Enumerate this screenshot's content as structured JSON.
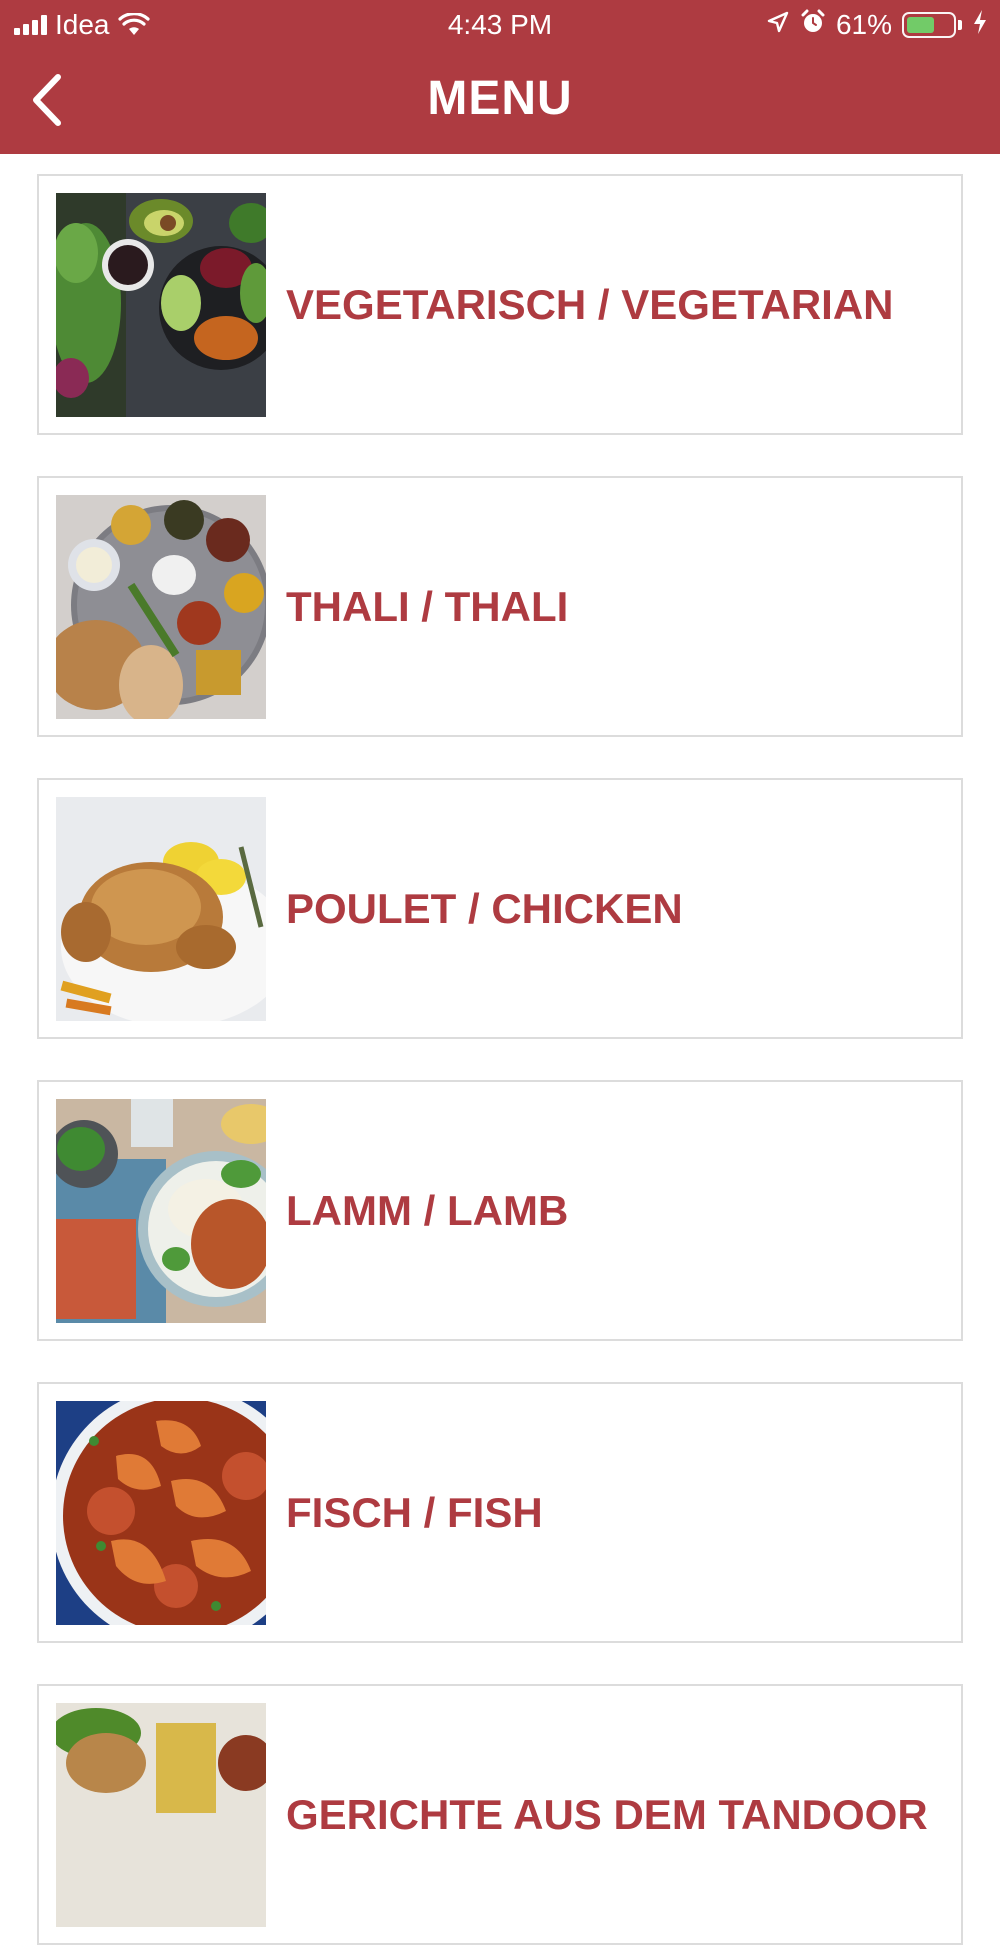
{
  "status_bar": {
    "carrier": "Idea",
    "time": "4:43 PM",
    "battery_percent": "61%",
    "battery_level": 0.61,
    "icons": [
      "signal-icon",
      "wifi-icon",
      "location-arrow-icon",
      "alarm-icon",
      "battery-icon",
      "charging-bolt-icon"
    ]
  },
  "header": {
    "title": "MENU",
    "back_icon": "chevron-left-icon",
    "background_color": "#ae3b41"
  },
  "accent_color": "#ae3b41",
  "menu": {
    "items": [
      {
        "label": "VEGETARISCH / VEGETARIAN",
        "image": "vegetarian-bowl-photo"
      },
      {
        "label": "THALI / THALI",
        "image": "thali-platter-photo"
      },
      {
        "label": "POULET / CHICKEN",
        "image": "roast-chicken-photo"
      },
      {
        "label": "LAMM / LAMB",
        "image": "lamb-curry-photo"
      },
      {
        "label": "FISCH / FISH",
        "image": "shrimp-curry-photo"
      },
      {
        "label": "GERICHTE AUS DEM TANDOOR",
        "image": "tandoor-dish-photo"
      }
    ]
  }
}
